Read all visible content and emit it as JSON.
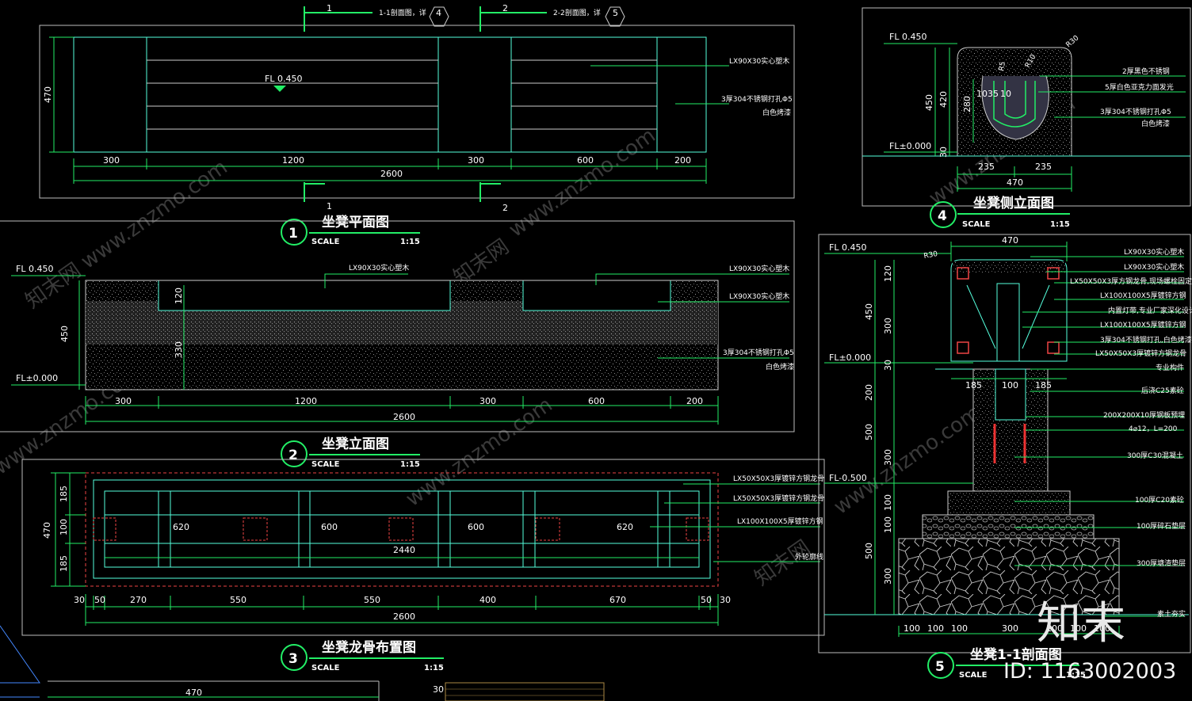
{
  "watermark": {
    "site": "www.znzmo.com",
    "brand": "知末网",
    "logo": "知末",
    "id": "ID: 1163002003"
  },
  "views": {
    "plan": {
      "num": "1",
      "title": "坐凳平面图",
      "scale_label": "SCALE",
      "scale": "1:15",
      "level": "FL 0.450",
      "height": "470",
      "dims": [
        "300",
        "1200",
        "300",
        "600",
        "200"
      ],
      "total": "2600",
      "notes": [
        "LX90X30实心塑木",
        "3厚304不锈钢打孔Φ5",
        "白色烤漆"
      ],
      "cut1": "1",
      "cut1_label": "1-1剖面图，详",
      "cut1_ref": "4",
      "cut2": "2",
      "cut2_label": "2-2剖面图，详",
      "cut2_ref": "5"
    },
    "elevation": {
      "num": "2",
      "title": "坐凳立面图",
      "scale_label": "SCALE",
      "scale": "1:15",
      "level_top": "FL 0.450",
      "level_base": "FL±0.000",
      "h_total": "450",
      "h_top": "120",
      "h_bottom": "330",
      "dims": [
        "300",
        "1200",
        "300",
        "600",
        "200"
      ],
      "total": "2600",
      "notes": [
        "LX90X30实心塑木",
        "LX90X30实心塑木",
        "LX90X30实心塑木",
        "3厚304不锈钢打孔Φ5",
        "白色烤漆"
      ]
    },
    "frame": {
      "num": "3",
      "title": "坐凳龙骨布置图",
      "scale_label": "SCALE",
      "scale": "1:15",
      "height": "470",
      "h_parts": [
        "185",
        "100",
        "185"
      ],
      "inner": [
        "620",
        "600",
        "600",
        "620"
      ],
      "inner_total": "2440",
      "dims": [
        "30",
        "50",
        "270",
        "550",
        "550",
        "400",
        "670",
        "50",
        "30"
      ],
      "total": "2600",
      "notes": [
        "LX50X50X3厚镀锌方钢龙骨",
        "LX50X50X3厚镀锌方钢龙骨",
        "LX100X100X5厚镀锌方钢",
        "外轮廓线"
      ]
    },
    "side": {
      "num": "4",
      "title": "坐凳侧立面图",
      "scale_label": "SCALE",
      "scale": "1:15",
      "level_top": "FL 0.450",
      "level_base": "FL±0.000",
      "h_total": "450",
      "h_420": "420",
      "h_30": "30",
      "h_280": "280",
      "radius": "R30",
      "r5": "R5",
      "r10": "R10",
      "d10": "10",
      "d35": "35",
      "d10b": "10",
      "w_left": "235",
      "w_right": "235",
      "width": "470",
      "notes": [
        "2厚黑色不锈钢",
        "5厚白色亚克力面发光",
        "3厚304不锈钢打孔Φ5",
        "白色烤漆"
      ]
    },
    "section": {
      "num": "5",
      "title": "坐凳1-1剖面图",
      "scale_label": "SCALE",
      "scale": "1:15",
      "width_top": "470",
      "radius": "R30",
      "levels": [
        "FL 0.450",
        "FL±0.000",
        "FL-0.500"
      ],
      "heights_outer": [
        "450",
        "200",
        "500",
        "500"
      ],
      "heights_inner": [
        "120",
        "300",
        "30",
        "300",
        "100",
        "100",
        "300"
      ],
      "w_mid": [
        "185",
        "100",
        "185"
      ],
      "w_base": [
        "100",
        "100",
        "100",
        "300",
        "100",
        "100",
        "100"
      ],
      "notes": [
        "LX90X30实心塑木",
        "LX90X30实心塑木",
        "LX50X50X3厚方钢龙骨,现场螺栓固定",
        "LX100X100X5厚镀锌方钢",
        "内置灯带,专业厂家深化设计",
        "LX100X100X5厚镀锌方钢",
        "3厚304不锈钢打孔,白色烤漆",
        "LX50X50X3厚镀锌方钢龙骨",
        "专业构件",
        "后浇C25素砼",
        "200X200X10厚钢板预埋",
        "4⌀12，L=200",
        "300厚C30混凝土",
        "100厚C20素砼",
        "100厚碎石垫层",
        "300厚塘渣垫层",
        "素土夯实"
      ]
    },
    "extra": {
      "dim": "470",
      "small": "30"
    }
  }
}
